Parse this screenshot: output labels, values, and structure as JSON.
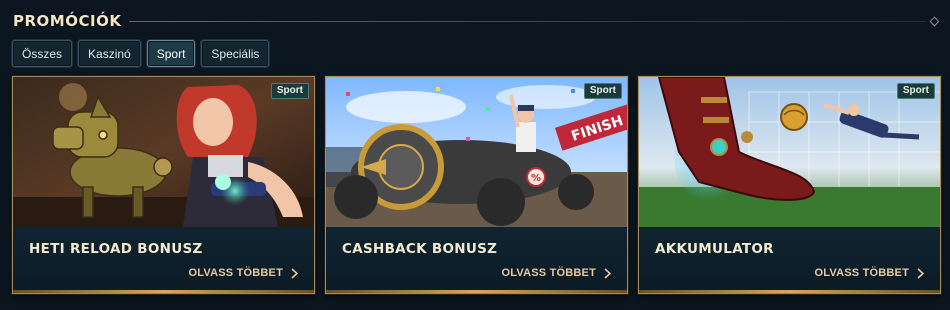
{
  "header": {
    "title": "PROMÓCIÓK"
  },
  "filters": [
    {
      "label": "Összes",
      "active": false
    },
    {
      "label": "Kaszinó",
      "active": false
    },
    {
      "label": "Sport",
      "active": true
    },
    {
      "label": "Speciális",
      "active": false
    }
  ],
  "cards": [
    {
      "badge": "Sport",
      "title": "HETI RELOAD BONUSZ",
      "cta": "OLVASS TÖBBET",
      "art": "robot-dog-and-heroine-illustration"
    },
    {
      "badge": "Sport",
      "title": "CASHBACK BONUSZ",
      "cta": "OLVASS TÖBBET",
      "art": "race-car-finish-line-illustration"
    },
    {
      "badge": "Sport",
      "title": "AKKUMULATOR",
      "cta": "OLVASS TÖBBET",
      "art": "soccer-boot-kick-goalkeeper-illustration"
    }
  ],
  "icons": {
    "read_more": "chevron-right-icon"
  },
  "colors": {
    "accent_gold": "#d4a860",
    "badge_bg": "#1a3b3a",
    "page_bg": "#0b1620"
  }
}
